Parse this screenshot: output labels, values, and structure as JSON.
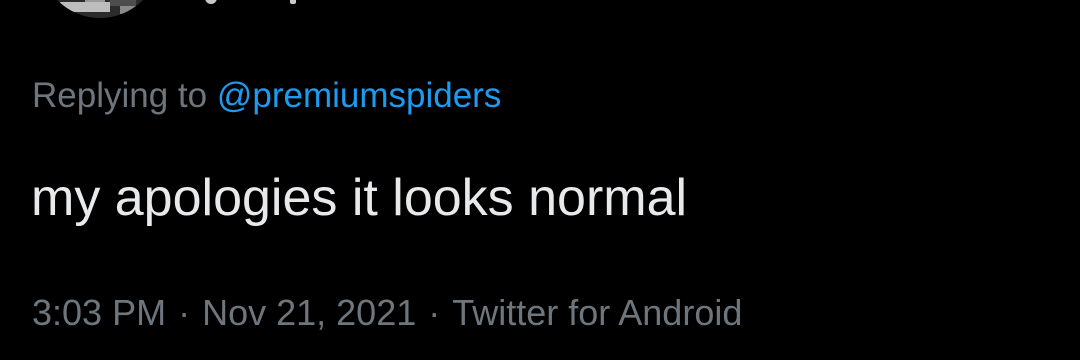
{
  "tweet": {
    "reply_prefix": "Replying to",
    "reply_handle": "@premiumspiders",
    "text": "my apologies it looks normal",
    "time": "3:03 PM",
    "separator": "·",
    "date": "Nov 21, 2021",
    "source": "Twitter for Android"
  },
  "colors": {
    "background": "#000000",
    "text_primary": "#e7e9ea",
    "text_secondary": "#6e767d",
    "link": "#1d9bf0"
  }
}
